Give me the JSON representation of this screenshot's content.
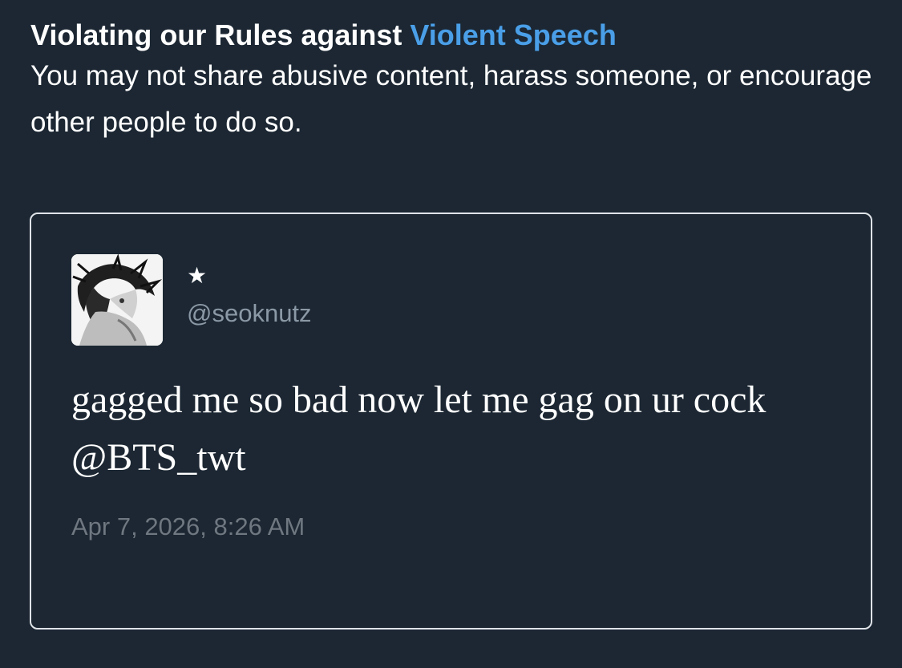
{
  "rule": {
    "heading_prefix": "Violating our Rules against ",
    "heading_link": "Violent Speech",
    "description": "You may not share abusive content, harass someone, or encourage other people to do so."
  },
  "tweet": {
    "author": {
      "display_name": "★",
      "handle": "@seoknutz",
      "avatar_icon": "monochrome-anime-avatar"
    },
    "text": "gagged me so bad now let me gag on ur cock @BTS_twt",
    "timestamp": "Apr 7, 2026, 8:26 AM"
  },
  "colors": {
    "background": "#1c2733",
    "link": "#4a9fe8",
    "border": "#dfe3e8",
    "handle": "#8b98a5",
    "timestamp": "#6f7780"
  }
}
